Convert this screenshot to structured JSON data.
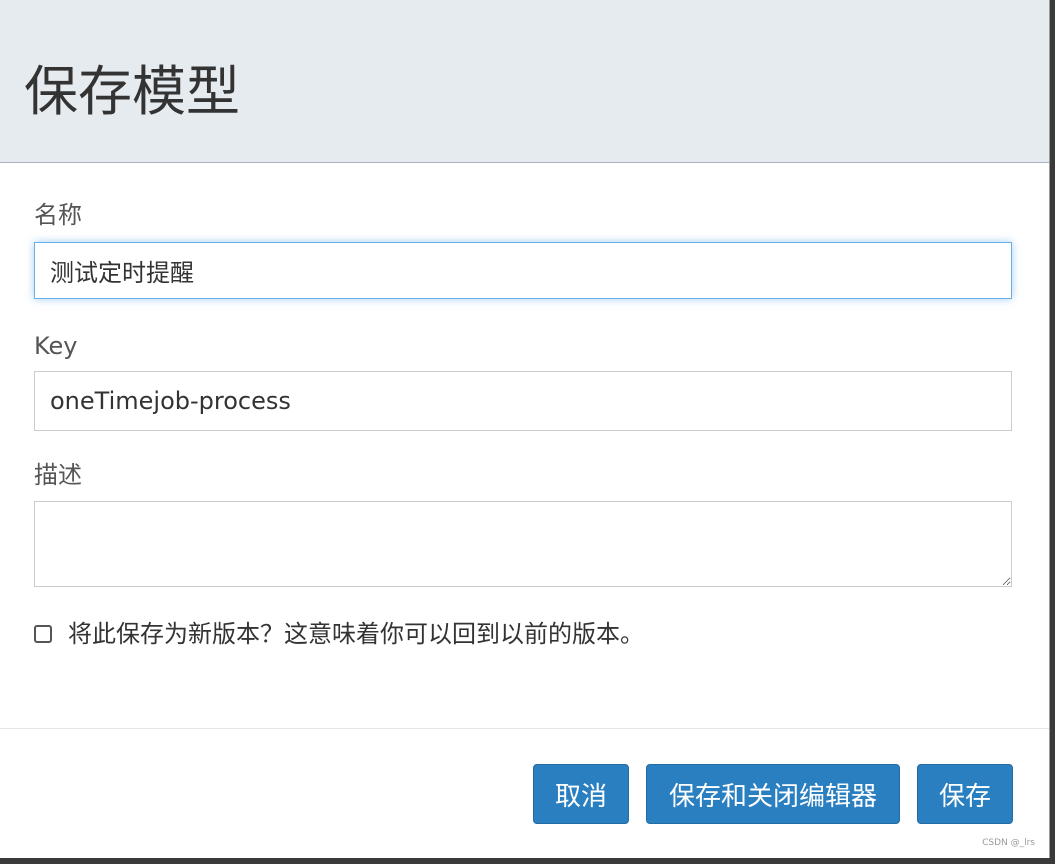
{
  "dialog": {
    "title": "保存模型"
  },
  "form": {
    "name_label": "名称",
    "name_value": "测试定时提醒",
    "key_label": "Key",
    "key_value": "oneTimejob-process",
    "description_label": "描述",
    "description_value": "",
    "new_version_checked": false,
    "new_version_label": "将此保存为新版本？这意味着你可以回到以前的版本。"
  },
  "buttons": {
    "cancel_label": "取消",
    "save_and_close_label": "保存和关闭编辑器",
    "save_label": "保存"
  },
  "colors": {
    "header_bg": "#e6ebf0",
    "primary_button": "#2a7fc0",
    "focus_border": "#66afe9"
  },
  "watermark": "CSDN @_lrs"
}
